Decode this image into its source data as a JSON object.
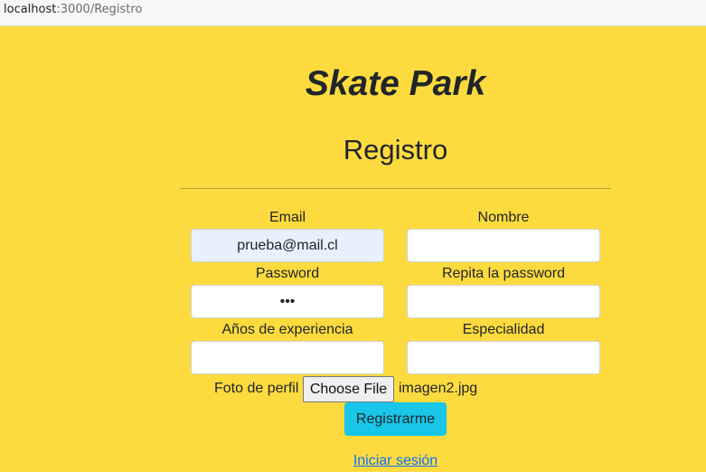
{
  "browser": {
    "url_host": "localhost",
    "url_rest": ":3000/Registro"
  },
  "page": {
    "title": "Skate Park",
    "subtitle": "Registro"
  },
  "form": {
    "email": {
      "label": "Email",
      "value": "prueba@mail.cl"
    },
    "nombre": {
      "label": "Nombre",
      "value": ""
    },
    "password": {
      "label": "Password",
      "value": "•••"
    },
    "repeat_password": {
      "label": "Repita la password",
      "value": ""
    },
    "experiencia": {
      "label": "Años de experiencia",
      "value": ""
    },
    "especialidad": {
      "label": "Especialidad",
      "value": ""
    },
    "foto": {
      "label": "Foto de perfil",
      "button": "Choose File",
      "file_name": "imagen2.jpg"
    },
    "submit_label": "Registrarme",
    "login_link": "Iniciar sesión"
  },
  "colors": {
    "background": "#fddb3e",
    "submit": "#17c6e8",
    "link": "#0d6efd",
    "autofill": "#e8f0fe"
  }
}
